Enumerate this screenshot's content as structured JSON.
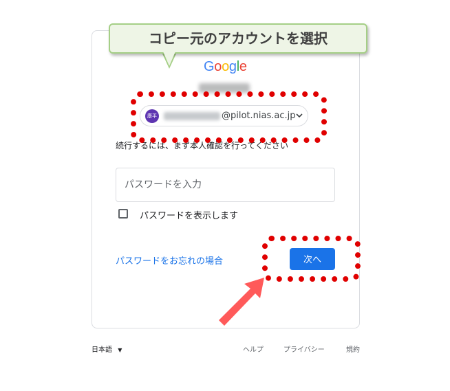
{
  "callout": {
    "text": "コピー元のアカウントを選択"
  },
  "logo": {
    "letters": [
      "G",
      "o",
      "o",
      "g",
      "l",
      "e"
    ],
    "colors": [
      "#4285f4",
      "#ea4335",
      "#fbbc05",
      "#4285f4",
      "#34a853",
      "#ea4335"
    ]
  },
  "account": {
    "avatar_text": "康平",
    "domain": "@pilot.nias.ac.jp",
    "chevron_icon": "chevron-down-icon"
  },
  "instruction": "続行するには、まず本人確認を行ってください",
  "password": {
    "placeholder": "パスワードを入力",
    "value": ""
  },
  "show_password_label": "パスワードを表示します",
  "forgot_link": "パスワードをお忘れの場合",
  "next_button": "次へ",
  "footer": {
    "language": "日本語",
    "links": [
      "ヘルプ",
      "プライバシー",
      "規約"
    ]
  },
  "colors": {
    "accent": "#1a73e8",
    "highlight": "#e00000",
    "callout_bg": "#eef5e6",
    "arrow": "#ff5a5a"
  }
}
